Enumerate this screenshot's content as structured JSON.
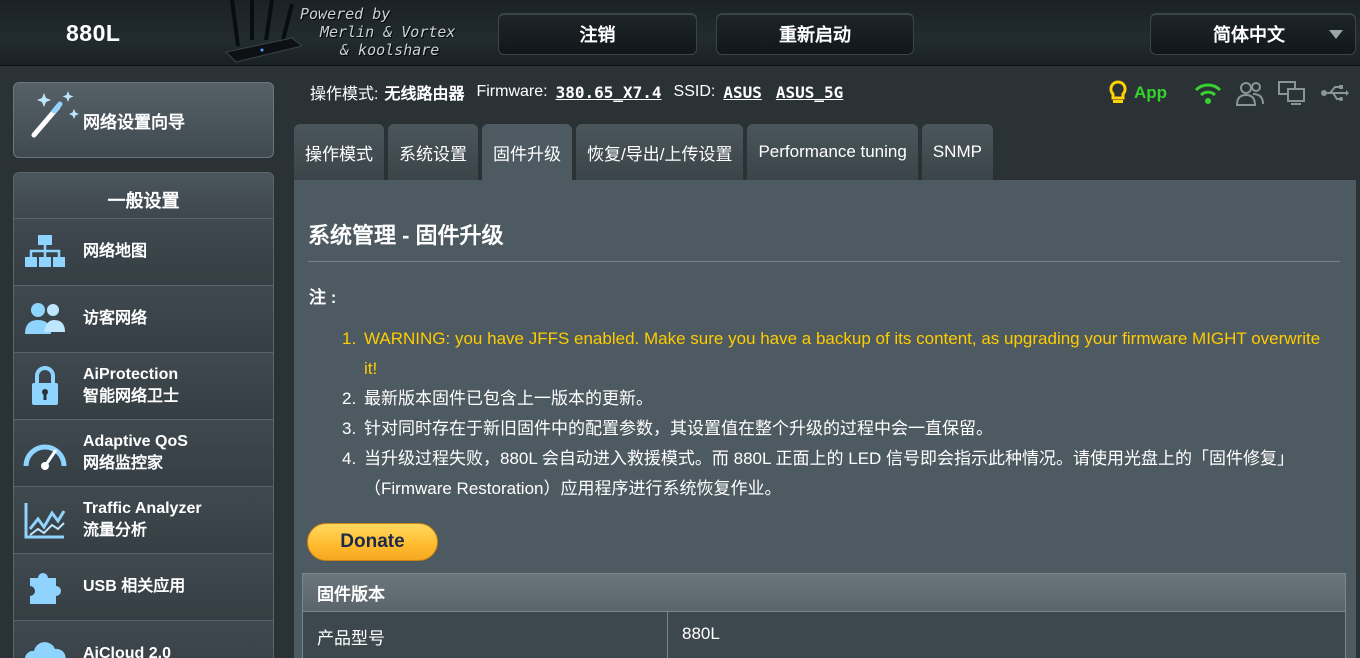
{
  "header": {
    "model": "880L",
    "powered_lines": [
      "Powered by",
      "Merlin & Vortex",
      "& koolshare"
    ],
    "logout_label": "注销",
    "reboot_label": "重新启动",
    "language_label": "简体中文"
  },
  "sidebar": {
    "wizard_label": "网络设置向导",
    "section_title": "一般设置",
    "items": [
      {
        "line1": "网络地图",
        "line2": "",
        "icon": "network-map-icon"
      },
      {
        "line1": "访客网络",
        "line2": "",
        "icon": "guest-network-icon"
      },
      {
        "line1": "AiProtection",
        "line2": "智能网络卫士",
        "icon": "lock-icon"
      },
      {
        "line1": "Adaptive QoS",
        "line2": "网络监控家",
        "icon": "speedometer-icon"
      },
      {
        "line1": "Traffic Analyzer",
        "line2": "流量分析",
        "icon": "traffic-chart-icon"
      },
      {
        "line1": "USB 相关应用",
        "line2": "",
        "icon": "puzzle-icon"
      },
      {
        "line1": "AiCloud 2.0",
        "line2": "",
        "icon": "cloud-icon"
      }
    ]
  },
  "status": {
    "mode_label": "操作模式:",
    "mode_value": "无线路由器",
    "firmware_label": "Firmware:",
    "firmware_value": "380.65_X7.4",
    "ssid_label": "SSID:",
    "ssid_1": "ASUS",
    "ssid_2": "ASUS_5G",
    "app_label": "App"
  },
  "tabs": [
    {
      "label": "操作模式"
    },
    {
      "label": "系统设置"
    },
    {
      "label": "固件升级"
    },
    {
      "label": "恢复/导出/上传设置"
    },
    {
      "label": "Performance tuning"
    },
    {
      "label": "SNMP"
    }
  ],
  "main": {
    "title": "系统管理 - 固件升级",
    "note_label": "注 :",
    "notes": [
      {
        "num": "1.",
        "text": "WARNING: you have JFFS enabled. Make sure you have a backup of its content, as upgrading your firmware MIGHT overwrite it!"
      },
      {
        "num": "2.",
        "text": "最新版本固件已包含上一版本的更新。"
      },
      {
        "num": "3.",
        "text": "针对同时存在于新旧固件中的配置参数，其设置值在整个升级的过程中会一直保留。"
      },
      {
        "num": "4.",
        "text": "当升级过程失败，880L 会自动进入救援模式。而 880L 正面上的 LED 信号即会指示此种情况。请使用光盘上的「固件修复」（Firmware Restoration）应用程序进行系统恢复作业。"
      }
    ],
    "donate_label": "Donate",
    "table_header": "固件版本",
    "rows": [
      {
        "key": "产品型号",
        "value": "880L"
      }
    ]
  },
  "colors": {
    "warning": "#ffcc00",
    "app_green": "#36d22f",
    "panel": "#4d5a61"
  }
}
